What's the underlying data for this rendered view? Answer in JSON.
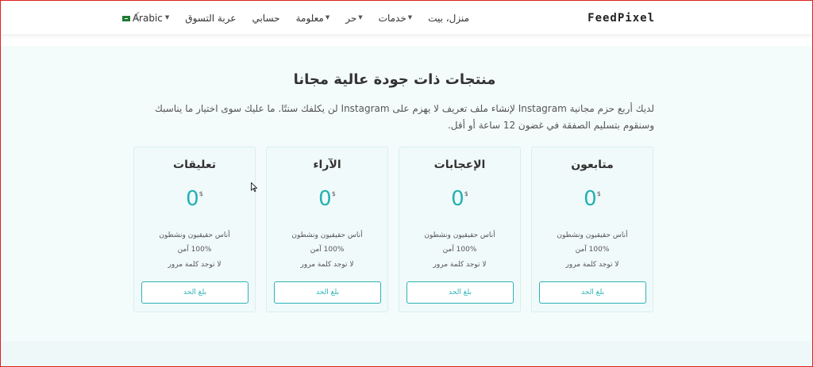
{
  "nav": {
    "logo": "FeedPixel",
    "items": [
      {
        "label": "منزل، بيت",
        "caret": false
      },
      {
        "label": "خدمات",
        "caret": true
      },
      {
        "label": "حر",
        "caret": true
      },
      {
        "label": "معلومة",
        "caret": true
      },
      {
        "label": "حسابي",
        "caret": false
      },
      {
        "label": "عربة التسوق",
        "caret": false
      }
    ],
    "language": "Arabic"
  },
  "section": {
    "title": "منتجات ذات جودة عالية مجانا",
    "description": "لديك أربع حزم مجانية Instagram لإنشاء ملف تعريف لا يهزم على Instagram لن يكلفك سنتًا. ما عليك سوى اختيار ما يناسبك وسنقوم بتسليم الصفقة في غضون 12 ساعة أو أقل."
  },
  "cards": [
    {
      "title": "متابعون",
      "price": "0",
      "currency": "$",
      "features": [
        "أناس حقيقيون ونشطون",
        "100% آمن",
        "لا توجد كلمة مرور"
      ],
      "button": "بلغ الحد"
    },
    {
      "title": "الإعجابات",
      "price": "0",
      "currency": "$",
      "features": [
        "أناس حقيقيون ونشطون",
        "100% آمن",
        "لا توجد كلمة مرور"
      ],
      "button": "بلغ الحد"
    },
    {
      "title": "الآراء",
      "price": "0",
      "currency": "$",
      "features": [
        "أناس حقيقيون ونشطون",
        "100% آمن",
        "لا توجد كلمة مرور"
      ],
      "button": "بلغ الحد"
    },
    {
      "title": "تعليقات",
      "price": "0",
      "currency": "$",
      "features": [
        "أناس حقيقيون ونشطون",
        "100% آمن",
        "لا توجد كلمة مرور"
      ],
      "button": "بلغ الحد"
    }
  ],
  "colors": {
    "accent": "#2bb3b5",
    "frame": "#e0201c",
    "section_bg": "#f4fbfb"
  },
  "icons": {
    "theme_toggle": "moon-icon",
    "flag": "saudi-flag-icon",
    "caret": "chevron-down-icon"
  }
}
